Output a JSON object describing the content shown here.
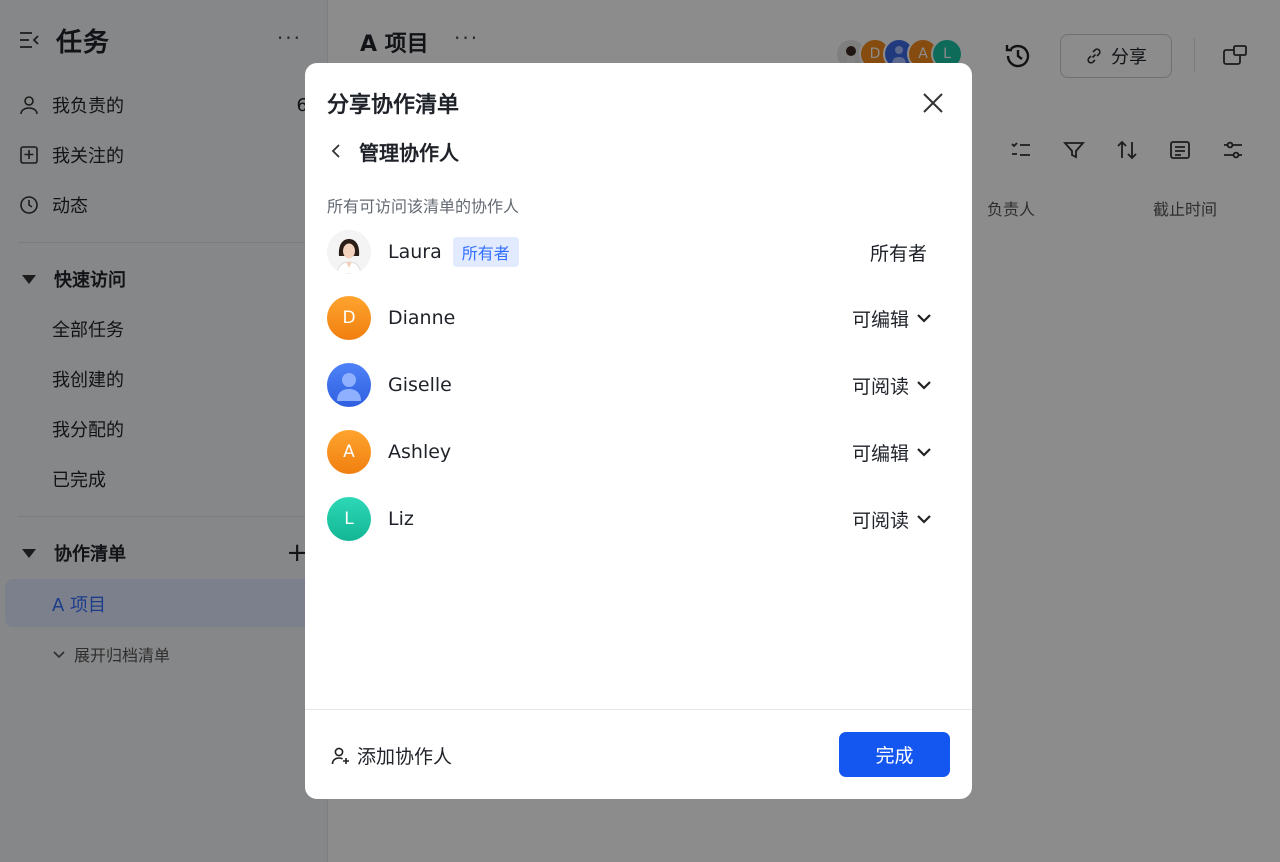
{
  "sidebar": {
    "title": "任务",
    "more": "···",
    "items": [
      {
        "label": "我负责的",
        "count": "6"
      },
      {
        "label": "我关注的"
      },
      {
        "label": "动态"
      }
    ],
    "quick_access": {
      "title": "快速访问",
      "items": [
        "全部任务",
        "我创建的",
        "我分配的",
        "已完成"
      ]
    },
    "collab_lists": {
      "title": "协作清单",
      "add": "+",
      "active_item": "A 项目",
      "archive_toggle": "展开归档清单"
    }
  },
  "header": {
    "title": "A 项目",
    "more": "···",
    "avatars": [
      {
        "letter": "",
        "color": "#e8e8e8"
      },
      {
        "letter": "D",
        "color": "#f5891a"
      },
      {
        "letter": "",
        "color": "#3d6be6"
      },
      {
        "letter": "A",
        "color": "#f5891a"
      },
      {
        "letter": "L",
        "color": "#1cc4a3"
      }
    ],
    "share_label": "分享"
  },
  "table_columns": [
    "负责人",
    "截止时间"
  ],
  "modal": {
    "title": "分享协作清单",
    "back_label": "管理协作人",
    "subtitle": "所有可访问该清单的协作人",
    "collaborators": [
      {
        "name": "Laura",
        "tag": "所有者",
        "permission": "所有者",
        "avatar_type": "photo"
      },
      {
        "name": "Dianne",
        "letter": "D",
        "color": "#f5891a",
        "permission": "可编辑"
      },
      {
        "name": "Giselle",
        "letter": "",
        "color": "#3d6be6",
        "permission": "可阅读",
        "avatar_type": "person"
      },
      {
        "name": "Ashley",
        "letter": "A",
        "color": "#f5891a",
        "permission": "可编辑"
      },
      {
        "name": "Liz",
        "letter": "L",
        "color": "#1cc4a3",
        "permission": "可阅读"
      }
    ],
    "add_label": "添加协作人",
    "done_label": "完成"
  },
  "colors": {
    "accent": "#1456f0",
    "tag_bg": "#e1eaff",
    "tag_text": "#3370ff"
  }
}
